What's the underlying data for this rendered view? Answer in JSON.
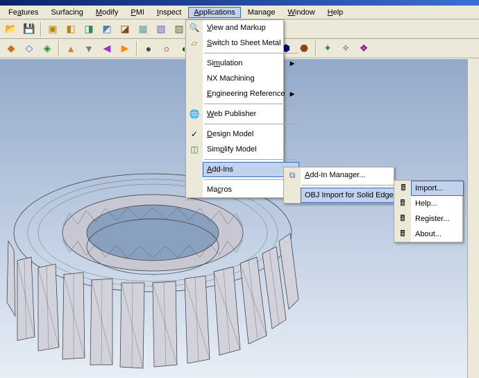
{
  "menubar": {
    "items": [
      {
        "label": "Features",
        "ul": "a"
      },
      {
        "label": "Surfacing",
        "active": false
      },
      {
        "label": "Modify",
        "ul": "M"
      },
      {
        "label": "PMI",
        "ul": "P"
      },
      {
        "label": "Inspect",
        "ul": "I"
      },
      {
        "label": "Applications",
        "ul": "A",
        "active": true
      },
      {
        "label": "Manage",
        "ul": "g"
      },
      {
        "label": "Window",
        "ul": "W"
      },
      {
        "label": "Help",
        "ul": "H"
      }
    ]
  },
  "applications_menu": {
    "items": [
      {
        "label": "View and Markup",
        "ul": "V",
        "icon": "magnifier"
      },
      {
        "label": "Switch to Sheet Metal",
        "ul": "S",
        "icon": "sheet"
      },
      {
        "label": "Simulation",
        "ul": "m",
        "submenu": true,
        "sep_after": false
      },
      {
        "label": "NX Machining",
        "icon": "nx"
      },
      {
        "label": "Engineering Reference",
        "ul": "E",
        "submenu": true
      },
      {
        "label": "Web Publisher",
        "ul": "W",
        "icon": "globe",
        "sep_before": true
      },
      {
        "label": "Design Model",
        "ul": "D",
        "icon": "check",
        "sep_before": true
      },
      {
        "label": "Simplify Model",
        "ul": "p",
        "icon": "simplify"
      },
      {
        "label": "Add-Ins",
        "ul": "A",
        "submenu": true,
        "selected": true,
        "sep_before": true
      },
      {
        "label": "Macros",
        "ul": "c",
        "submenu": true,
        "sep_before": true
      }
    ]
  },
  "addins_menu": {
    "item1": "Add-In Manager...",
    "item1_ul": "A",
    "item2": "OBJ Import for Solid Edge",
    "item1_icon": "addin-manager",
    "item2_selected": true
  },
  "obj_menu": {
    "items": [
      {
        "label": "Import...",
        "icon": "calc",
        "selected": true
      },
      {
        "label": "Help...",
        "icon": "calc"
      },
      {
        "label": "Register...",
        "icon": "calc"
      },
      {
        "label": "About...",
        "icon": "calc"
      }
    ]
  },
  "toolbar_row1_icons": [
    "open",
    "save",
    "box",
    "cube-y",
    "cube-g",
    "cube-t",
    "cyl",
    "cone",
    "sphere",
    "torus",
    "sep",
    "cut",
    "copy",
    "paste",
    "undo",
    "redo",
    "sep",
    "dim",
    "ang",
    "hole",
    "thread",
    "pattern",
    "mirror",
    "sep",
    "sketch",
    "plane",
    "axis",
    "sep",
    "mat",
    "color",
    "sep",
    "analyze",
    "render",
    "sep",
    "cam",
    "view"
  ],
  "colors": {
    "menu_highlight": "#c1d2ee",
    "menu_sel": "#316ac5",
    "viewport_top": "#93a9c9",
    "viewport_bot": "#e8eef6"
  }
}
